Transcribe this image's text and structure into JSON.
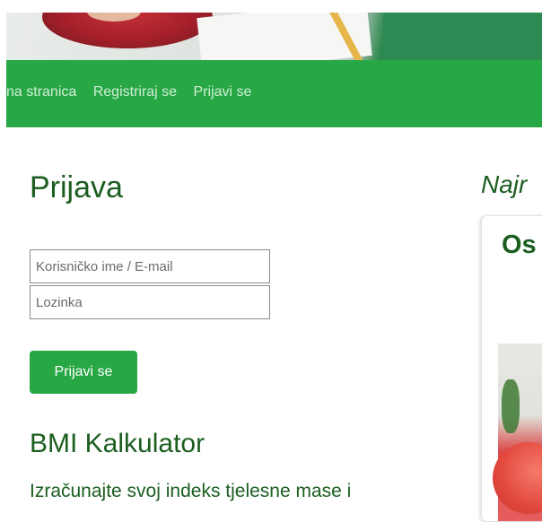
{
  "nav": {
    "links": [
      "na stranica",
      "Registriraj se",
      "Prijavi se"
    ]
  },
  "login": {
    "title": "Prijava",
    "username_placeholder": "Korisničko ime / E-mail",
    "password_placeholder": "Lozinka",
    "submit_label": "Prijavi se"
  },
  "bmi": {
    "title": "BMI Kalkulator",
    "text": "Izračunajte svoj indeks tjelesne mase i"
  },
  "side": {
    "heading": "Najr",
    "card_title": "Os"
  },
  "colors": {
    "brand_green": "#28a745",
    "heading_green": "#1b5e20"
  }
}
